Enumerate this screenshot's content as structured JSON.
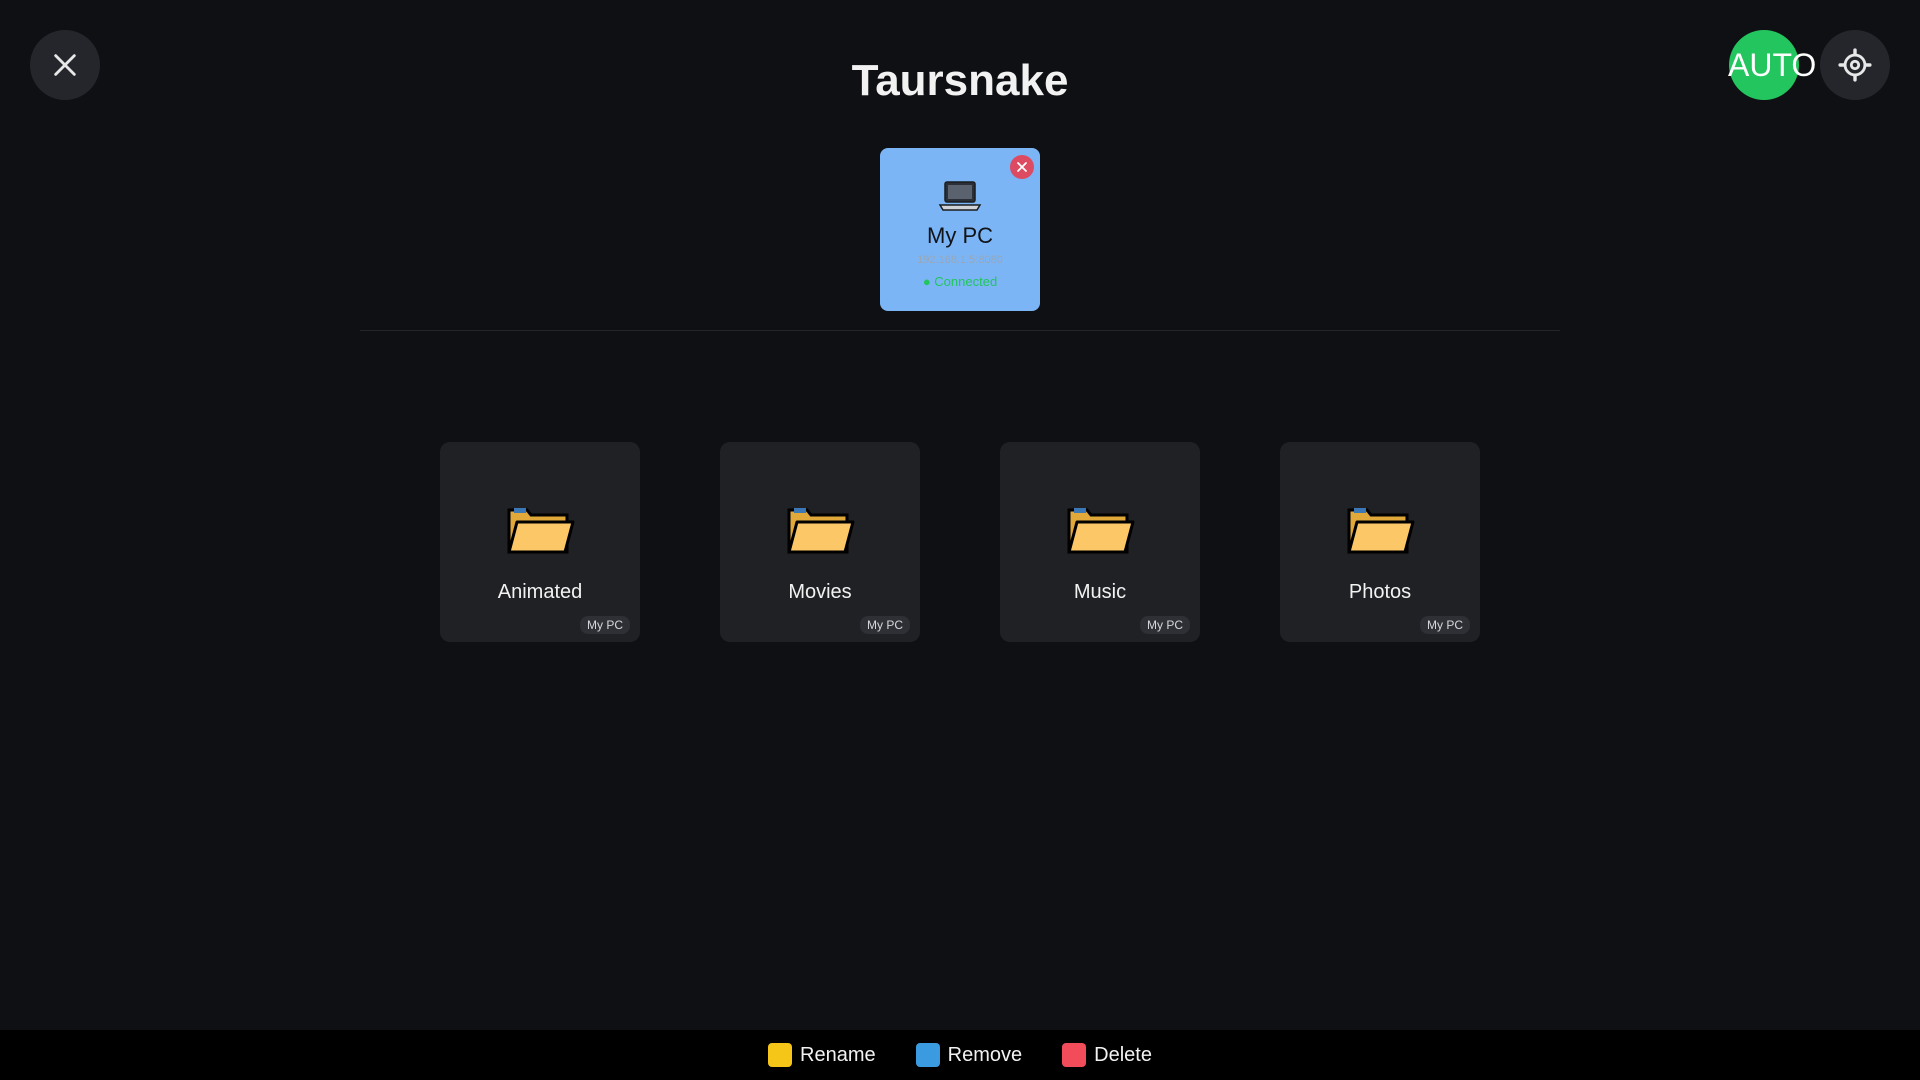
{
  "header": {
    "title": "Taursnake",
    "auto_label": "AUTO"
  },
  "device": {
    "name": "My PC",
    "address": "192.168.1.5:8080",
    "status": "● Connected",
    "icon": "laptop-icon"
  },
  "folders": [
    {
      "name": "Animated",
      "source": "My PC"
    },
    {
      "name": "Movies",
      "source": "My PC"
    },
    {
      "name": "Music",
      "source": "My PC"
    },
    {
      "name": "Photos",
      "source": "My PC"
    }
  ],
  "footer": {
    "rename": {
      "label": "Rename",
      "color": "#f5c518"
    },
    "remove": {
      "label": "Remove",
      "color": "#3b9be0"
    },
    "delete": {
      "label": "Delete",
      "color": "#f24b5a"
    }
  },
  "colors": {
    "background": "#0f1014",
    "device_card": "#7cb5f5",
    "auto": "#22c55e",
    "folder_card": "#202125"
  }
}
